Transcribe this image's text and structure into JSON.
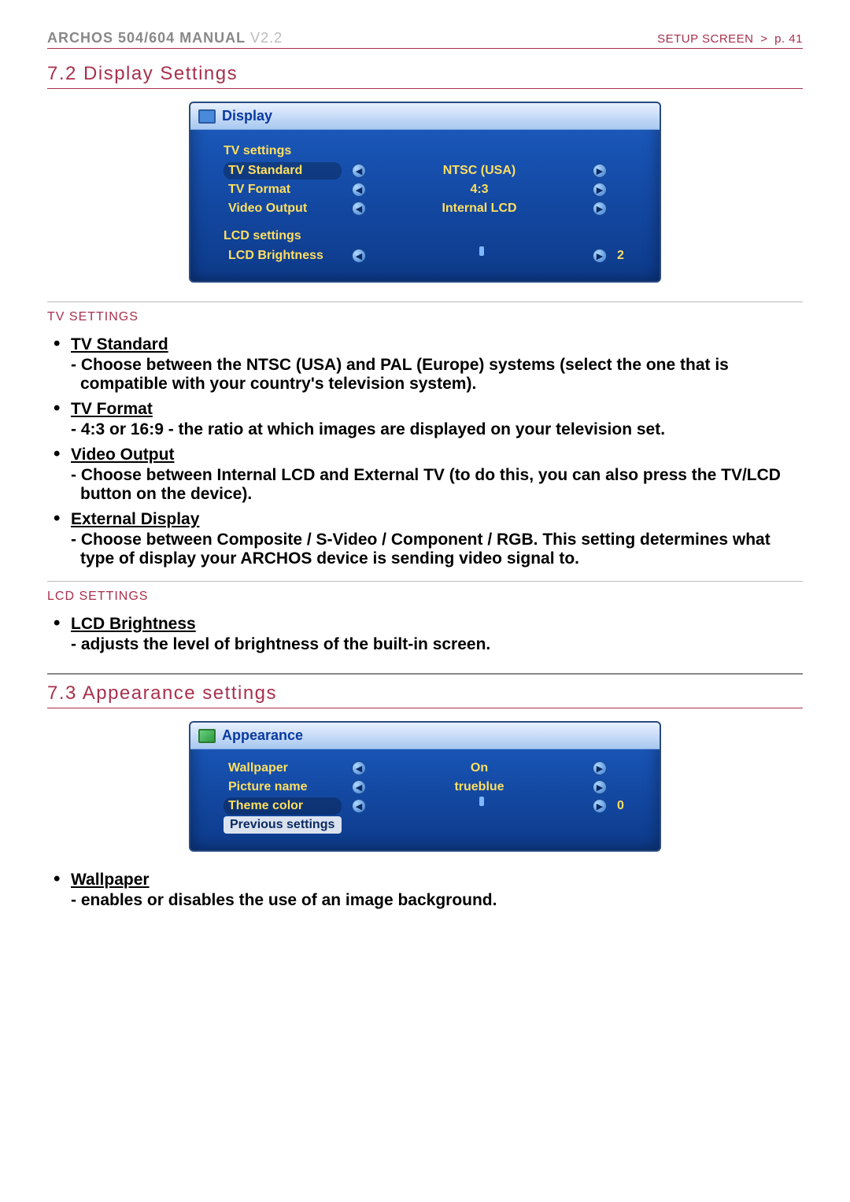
{
  "header": {
    "brand": "ARCHOS",
    "model": "504/604",
    "manual": "MANUAL",
    "version": "V2.2",
    "breadcrumb": "SETUP SCREEN",
    "gt": ">",
    "page": "p. 41"
  },
  "sections": {
    "display": {
      "title": "7.2  Display Settings",
      "screenshot": {
        "title": "Display",
        "groups": [
          {
            "label": "TV settings",
            "rows": [
              {
                "label": "TV Standard",
                "value": "NTSC (USA)",
                "selected": true
              },
              {
                "label": "TV Format",
                "value": "4:3"
              },
              {
                "label": "Video Output",
                "value": "Internal LCD"
              }
            ]
          },
          {
            "label": "LCD settings",
            "rows": [
              {
                "label": "LCD Brightness",
                "slider": true,
                "percent": 88,
                "thumb": 40,
                "num": "2"
              }
            ]
          }
        ]
      },
      "tv_settings_label": "TV SETTINGS",
      "bullets_tv": [
        {
          "title": "TV Standard",
          "desc": "Choose between the NTSC (USA) and PAL (Europe) systems (select the one that is compatible with your country's television system)."
        },
        {
          "title": "TV Format",
          "desc": "4:3 or 16:9 - the ratio at which images are displayed on your television set."
        },
        {
          "title": "Video Output",
          "desc": "Choose between Internal LCD and External TV (to do this, you can also press the TV/LCD button on the device)."
        },
        {
          "title": "External Display",
          "desc": "Choose between Composite / S-Video / Component / RGB. This setting determines what type of display your ARCHOS device is sending video signal to."
        }
      ],
      "lcd_settings_label": "LCD SETTINGS",
      "bullets_lcd": [
        {
          "title": "LCD Brightness",
          "desc": "adjusts the level of brightness of the built-in screen."
        }
      ]
    },
    "appearance": {
      "title": "7.3  Appearance settings",
      "screenshot": {
        "title": "Appearance",
        "rows": [
          {
            "label": "Wallpaper",
            "value": "On"
          },
          {
            "label": "Picture name",
            "value": "trueblue"
          },
          {
            "label": "Theme color",
            "slider": true,
            "percent": 15,
            "thumb": 15,
            "num": "0",
            "selected": true
          },
          {
            "label": "Previous settings",
            "boxed": true
          }
        ]
      },
      "bullets": [
        {
          "title": "Wallpaper",
          "desc": "enables or disables the use of an image background."
        }
      ]
    }
  },
  "glyphs": {
    "left": "◀",
    "right": "▶"
  }
}
